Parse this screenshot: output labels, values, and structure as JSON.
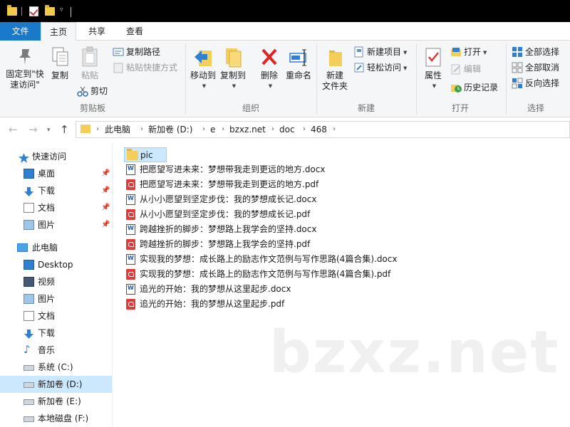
{
  "ribbon_tabs": {
    "file": "文件",
    "home": "主页",
    "share": "共享",
    "view": "查看"
  },
  "clipboard": {
    "pin_quick_access": "固定到\"快速访问\"",
    "pin_line1": "固定到\"快",
    "pin_line2": "速访问\"",
    "copy": "复制",
    "paste": "粘贴",
    "copy_path": "复制路径",
    "paste_shortcut": "粘贴快捷方式",
    "cut": "剪切",
    "group": "剪贴板"
  },
  "organize": {
    "move_to": "移动到",
    "copy_to": "复制到",
    "delete": "删除",
    "rename": "重命名",
    "group": "组织"
  },
  "new": {
    "new_item": "新建项目",
    "easy_access": "轻松访问",
    "new_folder_line1": "新建",
    "new_folder_line2": "文件夹",
    "group": "新建"
  },
  "open": {
    "properties": "属性",
    "open": "打开",
    "edit": "编辑",
    "history": "历史记录",
    "group": "打开"
  },
  "select": {
    "select_all": "全部选择",
    "select_none": "全部取消",
    "invert": "反向选择",
    "group": "选择"
  },
  "breadcrumb": [
    "此电脑",
    "新加卷 (D:)",
    "e",
    "bzxz.net",
    "doc",
    "468"
  ],
  "sidebar": {
    "quick_access": "快速访问",
    "quick_items": [
      "桌面",
      "下载",
      "文档",
      "图片"
    ],
    "this_pc": "此电脑",
    "pc_items": [
      "Desktop",
      "视频",
      "图片",
      "文档",
      "下载",
      "音乐",
      "系统 (C:)",
      "新加卷 (D:)",
      "新加卷 (E:)",
      "本地磁盘 (F:)"
    ]
  },
  "files": [
    {
      "name": "pic",
      "type": "folder"
    },
    {
      "name": "把愿望写进未来：梦想带我走到更远的地方.docx",
      "type": "docx"
    },
    {
      "name": "把愿望写进未来：梦想带我走到更远的地方.pdf",
      "type": "pdf"
    },
    {
      "name": "从小小愿望到坚定步伐：我的梦想成长记.docx",
      "type": "docx"
    },
    {
      "name": "从小小愿望到坚定步伐：我的梦想成长记.pdf",
      "type": "pdf"
    },
    {
      "name": "跨越挫折的脚步：梦想路上我学会的坚持.docx",
      "type": "docx"
    },
    {
      "name": "跨越挫折的脚步：梦想路上我学会的坚持.pdf",
      "type": "pdf"
    },
    {
      "name": "实现我的梦想：成长路上的励志作文范例与写作思路(4篇合集).docx",
      "type": "docx"
    },
    {
      "name": "实现我的梦想：成长路上的励志作文范例与写作思路(4篇合集).pdf",
      "type": "pdf"
    },
    {
      "name": "追光的开始：我的梦想从这里起步.docx",
      "type": "docx"
    },
    {
      "name": "追光的开始：我的梦想从这里起步.pdf",
      "type": "pdf"
    }
  ],
  "watermark": "bzxz.net",
  "colors": {
    "accent": "#1979ca",
    "selection": "#cce8ff",
    "folder": "#f5cd5b",
    "pdf": "#e03b3b"
  }
}
